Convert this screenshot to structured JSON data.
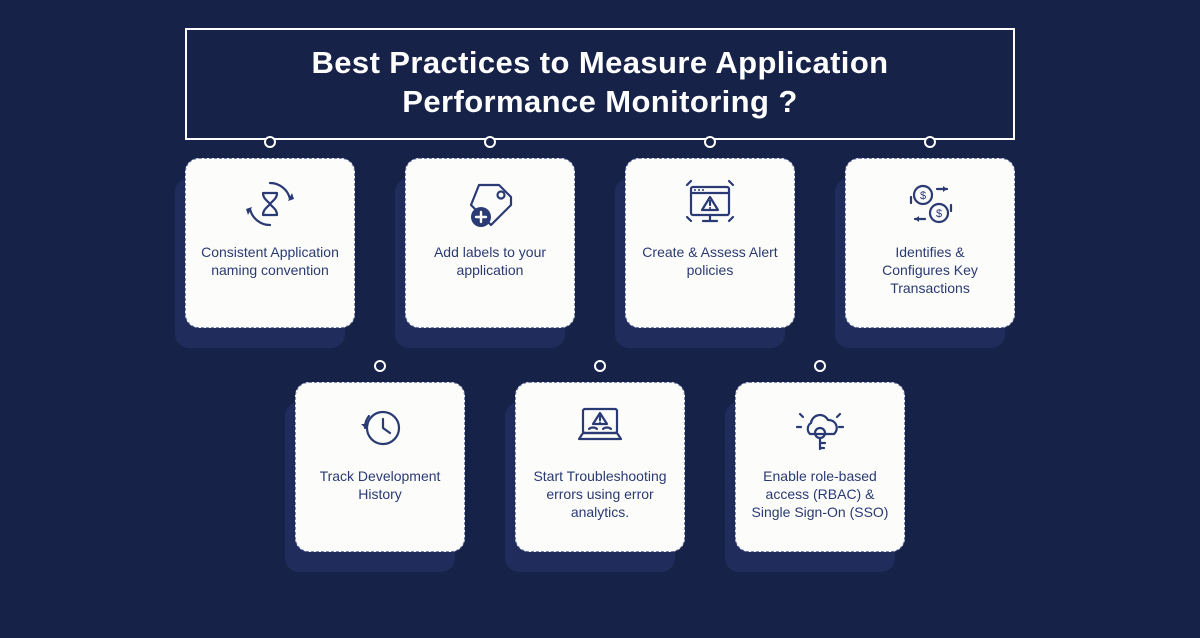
{
  "title": {
    "line1": "Best Practices to Measure Application",
    "line2": "Performance Monitoring ?"
  },
  "cards": [
    {
      "icon": "hourglass-cycle-icon",
      "label": "Consistent Application naming convention"
    },
    {
      "icon": "tag-plus-icon",
      "label": "Add labels to your application"
    },
    {
      "icon": "alert-monitor-icon",
      "label": "Create & Assess Alert policies"
    },
    {
      "icon": "money-transfer-icon",
      "label": "Identifies & Configures Key Transactions"
    },
    {
      "icon": "clock-history-icon",
      "label": "Track Development History"
    },
    {
      "icon": "laptop-error-icon",
      "label": "Start Troubleshooting errors using error analytics."
    },
    {
      "icon": "cloud-key-icon",
      "label": "Enable role-based access (RBAC) & Single Sign-On (SSO)"
    }
  ]
}
